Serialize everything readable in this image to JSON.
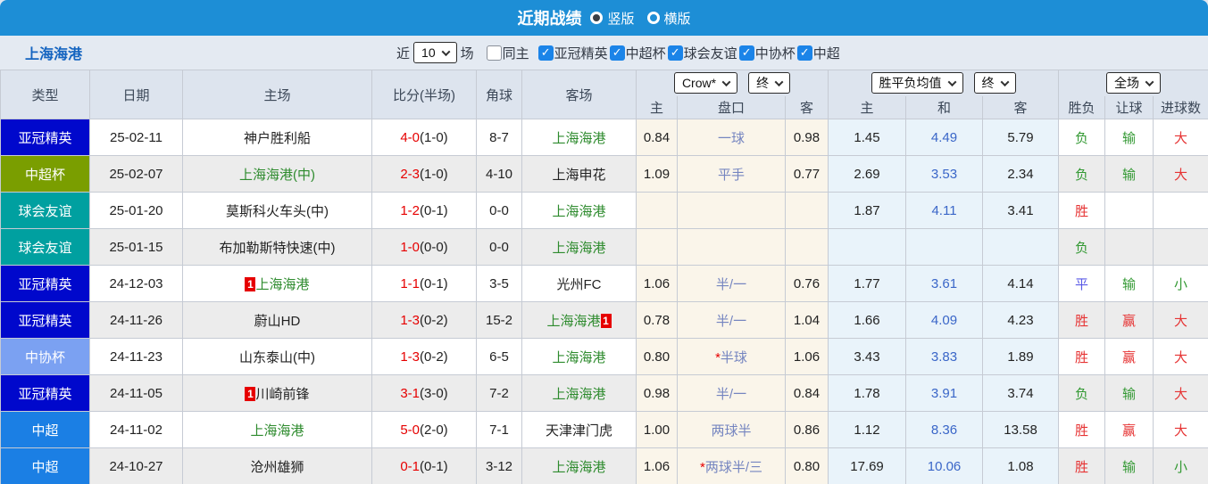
{
  "titlebar": {
    "title": "近期战绩",
    "radios": [
      {
        "label": "竖版",
        "selected": true
      },
      {
        "label": "横版",
        "selected": false
      }
    ]
  },
  "filterbar": {
    "team": "上海海港",
    "recent_label": "近",
    "recent_count": "10",
    "unit_label": "场",
    "checkboxes": [
      {
        "label": "同主",
        "checked": false
      },
      {
        "label": "亚冠精英",
        "checked": true
      },
      {
        "label": "中超杯",
        "checked": true
      },
      {
        "label": "球会友谊",
        "checked": true
      },
      {
        "label": "中协杯",
        "checked": true
      },
      {
        "label": "中超",
        "checked": true
      }
    ]
  },
  "table": {
    "selects": {
      "bookmaker": "Crow*",
      "bookmaker_stage": "终",
      "avg_name": "胜平负均值",
      "avg_stage": "终",
      "scope": "全场"
    },
    "headers": {
      "type": "类型",
      "date": "日期",
      "home": "主场",
      "score": "比分(半场)",
      "corner": "角球",
      "away": "客场",
      "odds_home": "主",
      "handicap": "盘口",
      "odds_away": "客",
      "avg_home": "主",
      "avg_draw": "和",
      "avg_away": "客",
      "wdl": "胜负",
      "let_goal": "让球",
      "goals": "进球数"
    },
    "type_colors": {
      "亚冠精英": "#0008cc",
      "中超杯": "#7a9e00",
      "球会友谊": "#00a0a0",
      "中协杯": "#7ba1f2",
      "中超": "#1b7fe4"
    },
    "rows": [
      {
        "type": "亚冠精英",
        "date": "25-02-11",
        "home": {
          "name": "神户胜利船",
          "green": false,
          "card_before": "",
          "card_after": ""
        },
        "score": "4-0",
        "half": "1-0",
        "corner": "8-7",
        "away": {
          "name": "上海海港",
          "green": true,
          "card_before": "",
          "card_after": ""
        },
        "odds_home": "0.84",
        "handicap": "一球",
        "handicap_star": false,
        "odds_away": "0.98",
        "avg_home": "1.45",
        "avg_draw": "4.49",
        "avg_away": "5.79",
        "result": {
          "text": "负",
          "c": "g"
        },
        "let_goal": {
          "text": "输",
          "c": "g"
        },
        "goals": {
          "text": "大",
          "c": "r"
        }
      },
      {
        "type": "中超杯",
        "date": "25-02-07",
        "home": {
          "name": "上海海港(中)",
          "green": true,
          "card_before": "",
          "card_after": ""
        },
        "score": "2-3",
        "half": "1-0",
        "corner": "4-10",
        "away": {
          "name": "上海申花",
          "green": false,
          "card_before": "",
          "card_after": ""
        },
        "odds_home": "1.09",
        "handicap": "平手",
        "handicap_star": false,
        "odds_away": "0.77",
        "avg_home": "2.69",
        "avg_draw": "3.53",
        "avg_away": "2.34",
        "result": {
          "text": "负",
          "c": "g"
        },
        "let_goal": {
          "text": "输",
          "c": "g"
        },
        "goals": {
          "text": "大",
          "c": "r"
        }
      },
      {
        "type": "球会友谊",
        "date": "25-01-20",
        "home": {
          "name": "莫斯科火车头(中)",
          "green": false,
          "card_before": "",
          "card_after": ""
        },
        "score": "1-2",
        "half": "0-1",
        "corner": "0-0",
        "away": {
          "name": "上海海港",
          "green": true,
          "card_before": "",
          "card_after": ""
        },
        "odds_home": "",
        "handicap": "",
        "handicap_star": false,
        "odds_away": "",
        "avg_home": "1.87",
        "avg_draw": "4.11",
        "avg_away": "3.41",
        "result": {
          "text": "胜",
          "c": "r"
        },
        "let_goal": {
          "text": "",
          "c": ""
        },
        "goals": {
          "text": "",
          "c": ""
        }
      },
      {
        "type": "球会友谊",
        "date": "25-01-15",
        "home": {
          "name": "布加勒斯特快速(中)",
          "green": false,
          "card_before": "",
          "card_after": ""
        },
        "score": "1-0",
        "half": "0-0",
        "corner": "0-0",
        "away": {
          "name": "上海海港",
          "green": true,
          "card_before": "",
          "card_after": ""
        },
        "odds_home": "",
        "handicap": "",
        "handicap_star": false,
        "odds_away": "",
        "avg_home": "",
        "avg_draw": "",
        "avg_away": "",
        "result": {
          "text": "负",
          "c": "g"
        },
        "let_goal": {
          "text": "",
          "c": ""
        },
        "goals": {
          "text": "",
          "c": ""
        }
      },
      {
        "type": "亚冠精英",
        "date": "24-12-03",
        "home": {
          "name": "上海海港",
          "green": true,
          "card_before": "1",
          "card_after": ""
        },
        "score": "1-1",
        "half": "0-1",
        "corner": "3-5",
        "away": {
          "name": "光州FC",
          "green": false,
          "card_before": "",
          "card_after": ""
        },
        "odds_home": "1.06",
        "handicap": "半/一",
        "handicap_star": false,
        "odds_away": "0.76",
        "avg_home": "1.77",
        "avg_draw": "3.61",
        "avg_away": "4.14",
        "result": {
          "text": "平",
          "c": "b"
        },
        "let_goal": {
          "text": "输",
          "c": "g"
        },
        "goals": {
          "text": "小",
          "c": "g"
        }
      },
      {
        "type": "亚冠精英",
        "date": "24-11-26",
        "home": {
          "name": "蔚山HD",
          "green": false,
          "card_before": "",
          "card_after": ""
        },
        "score": "1-3",
        "half": "0-2",
        "corner": "15-2",
        "away": {
          "name": "上海海港",
          "green": true,
          "card_before": "",
          "card_after": "1"
        },
        "odds_home": "0.78",
        "handicap": "半/一",
        "handicap_star": false,
        "odds_away": "1.04",
        "avg_home": "1.66",
        "avg_draw": "4.09",
        "avg_away": "4.23",
        "result": {
          "text": "胜",
          "c": "r"
        },
        "let_goal": {
          "text": "赢",
          "c": "r"
        },
        "goals": {
          "text": "大",
          "c": "r"
        }
      },
      {
        "type": "中协杯",
        "date": "24-11-23",
        "home": {
          "name": "山东泰山(中)",
          "green": false,
          "card_before": "",
          "card_after": ""
        },
        "score": "1-3",
        "half": "0-2",
        "corner": "6-5",
        "away": {
          "name": "上海海港",
          "green": true,
          "card_before": "",
          "card_after": ""
        },
        "odds_home": "0.80",
        "handicap": "半球",
        "handicap_star": true,
        "odds_away": "1.06",
        "avg_home": "3.43",
        "avg_draw": "3.83",
        "avg_away": "1.89",
        "result": {
          "text": "胜",
          "c": "r"
        },
        "let_goal": {
          "text": "赢",
          "c": "r"
        },
        "goals": {
          "text": "大",
          "c": "r"
        }
      },
      {
        "type": "亚冠精英",
        "date": "24-11-05",
        "home": {
          "name": "川崎前锋",
          "green": false,
          "card_before": "1",
          "card_after": ""
        },
        "score": "3-1",
        "half": "3-0",
        "corner": "7-2",
        "away": {
          "name": "上海海港",
          "green": true,
          "card_before": "",
          "card_after": ""
        },
        "odds_home": "0.98",
        "handicap": "半/一",
        "handicap_star": false,
        "odds_away": "0.84",
        "avg_home": "1.78",
        "avg_draw": "3.91",
        "avg_away": "3.74",
        "result": {
          "text": "负",
          "c": "g"
        },
        "let_goal": {
          "text": "输",
          "c": "g"
        },
        "goals": {
          "text": "大",
          "c": "r"
        }
      },
      {
        "type": "中超",
        "date": "24-11-02",
        "home": {
          "name": "上海海港",
          "green": true,
          "card_before": "",
          "card_after": ""
        },
        "score": "5-0",
        "half": "2-0",
        "corner": "7-1",
        "away": {
          "name": "天津津门虎",
          "green": false,
          "card_before": "",
          "card_after": ""
        },
        "odds_home": "1.00",
        "handicap": "两球半",
        "handicap_star": false,
        "odds_away": "0.86",
        "avg_home": "1.12",
        "avg_draw": "8.36",
        "avg_away": "13.58",
        "result": {
          "text": "胜",
          "c": "r"
        },
        "let_goal": {
          "text": "赢",
          "c": "r"
        },
        "goals": {
          "text": "大",
          "c": "r"
        }
      },
      {
        "type": "中超",
        "date": "24-10-27",
        "home": {
          "name": "沧州雄狮",
          "green": false,
          "card_before": "",
          "card_after": ""
        },
        "score": "0-1",
        "half": "0-1",
        "corner": "3-12",
        "away": {
          "name": "上海海港",
          "green": true,
          "card_before": "",
          "card_after": ""
        },
        "odds_home": "1.06",
        "handicap": "两球半/三",
        "handicap_star": true,
        "odds_away": "0.80",
        "avg_home": "17.69",
        "avg_draw": "10.06",
        "avg_away": "1.08",
        "result": {
          "text": "胜",
          "c": "r"
        },
        "let_goal": {
          "text": "输",
          "c": "g"
        },
        "goals": {
          "text": "小",
          "c": "g"
        }
      }
    ]
  }
}
